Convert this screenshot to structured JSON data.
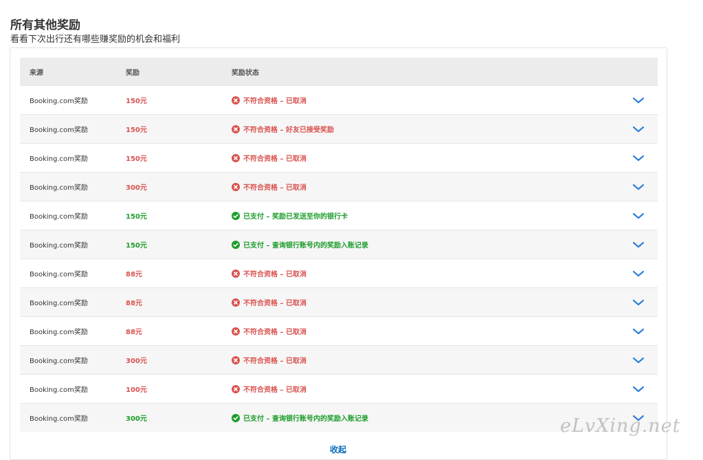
{
  "header": {
    "title": "所有其他奖励",
    "subtitle": "看看下次出行还有哪些赚奖励的机会和福利"
  },
  "table": {
    "columns": [
      "来源",
      "奖励",
      "奖励状态"
    ],
    "rows": [
      {
        "source": "Booking.com奖励",
        "amount": "150元",
        "status": "不符合资格 – 已取消",
        "state": "ineligible"
      },
      {
        "source": "Booking.com奖励",
        "amount": "150元",
        "status": "不符合资格 – 好友已接受奖励",
        "state": "ineligible"
      },
      {
        "source": "Booking.com奖励",
        "amount": "150元",
        "status": "不符合资格 – 已取消",
        "state": "ineligible"
      },
      {
        "source": "Booking.com奖励",
        "amount": "300元",
        "status": "不符合资格 – 已取消",
        "state": "ineligible"
      },
      {
        "source": "Booking.com奖励",
        "amount": "150元",
        "status": "已支付 – 奖励已发送至你的银行卡",
        "state": "paid"
      },
      {
        "source": "Booking.com奖励",
        "amount": "150元",
        "status": "已支付 – 查询银行账号内的奖励入账记录",
        "state": "paid"
      },
      {
        "source": "Booking.com奖励",
        "amount": "88元",
        "status": "不符合资格 – 已取消",
        "state": "ineligible"
      },
      {
        "source": "Booking.com奖励",
        "amount": "88元",
        "status": "不符合资格 – 已取消",
        "state": "ineligible"
      },
      {
        "source": "Booking.com奖励",
        "amount": "88元",
        "status": "不符合资格 – 已取消",
        "state": "ineligible"
      },
      {
        "source": "Booking.com奖励",
        "amount": "300元",
        "status": "不符合资格 – 已取消",
        "state": "ineligible"
      },
      {
        "source": "Booking.com奖励",
        "amount": "100元",
        "status": "不符合资格 – 已取消",
        "state": "ineligible"
      },
      {
        "source": "Booking.com奖励",
        "amount": "300元",
        "status": "已支付 – 查询银行账号内的奖励入账记录",
        "state": "paid"
      }
    ]
  },
  "footer": {
    "collapse_label": "收起"
  },
  "watermark": "eLvXing.net",
  "icons": {
    "ineligible": "cross-circle-icon",
    "paid": "check-circle-icon",
    "expand": "chevron-down-icon"
  },
  "colors": {
    "ineligible": "#d9534f",
    "paid": "#1d9d2b",
    "chevron": "#2f80d8",
    "link": "#0b6cbd",
    "header_bg": "#ececec"
  }
}
